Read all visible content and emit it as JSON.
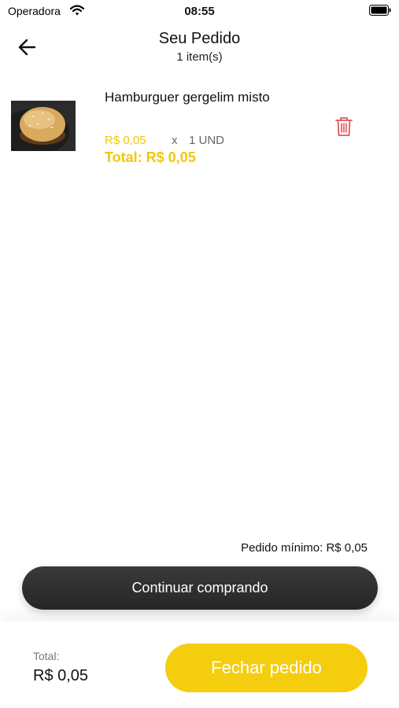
{
  "status_bar": {
    "carrier": "Operadora",
    "time": "08:55"
  },
  "header": {
    "title": "Seu Pedido",
    "subtitle": "1 item(s)"
  },
  "cart": {
    "items": [
      {
        "name": "Hamburguer gergelim misto",
        "unit_price": "R$ 0,05",
        "times": "x",
        "quantity": "1 UND",
        "total": "Total: R$ 0,05"
      }
    ]
  },
  "minimum_order": "Pedido mínimo: R$ 0,05",
  "continue_button": "Continuar comprando",
  "footer": {
    "total_label": "Total:",
    "total_value": "R$ 0,05",
    "checkout_button": "Fechar pedido"
  },
  "colors": {
    "accent": "#f5cd0f",
    "dark_button": "#2e2e2e",
    "delete_icon": "#e05555"
  }
}
